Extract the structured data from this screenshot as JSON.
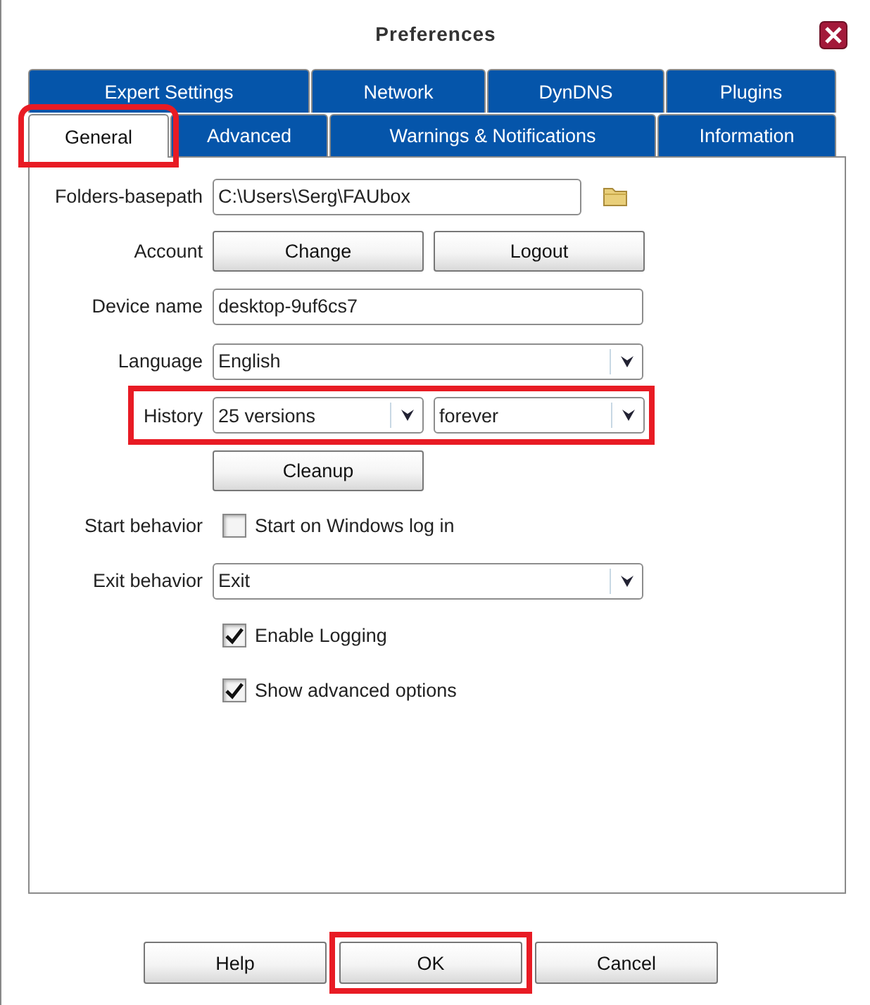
{
  "window": {
    "title": "Preferences"
  },
  "tab_rows": [
    [
      {
        "label": "Expert Settings",
        "selected": false,
        "highlighted": false
      },
      {
        "label": "Network",
        "selected": false,
        "highlighted": false
      },
      {
        "label": "DynDNS",
        "selected": false,
        "highlighted": false
      },
      {
        "label": "Plugins",
        "selected": false,
        "highlighted": false
      }
    ],
    [
      {
        "label": "General",
        "selected": true,
        "highlighted": true
      },
      {
        "label": "Advanced",
        "selected": false,
        "highlighted": false
      },
      {
        "label": "Warnings & Notifications",
        "selected": false,
        "highlighted": false
      },
      {
        "label": "Information",
        "selected": false,
        "highlighted": false
      }
    ]
  ],
  "settings": [
    {
      "kind": "path",
      "label": "Folders-basepath",
      "value": "C:\\Users\\Serg\\FAUbox"
    },
    {
      "kind": "buttons",
      "label": "Account",
      "buttons": [
        "Change",
        "Logout"
      ]
    },
    {
      "kind": "text",
      "label": "Device name",
      "value": "desktop-9uf6cs7"
    },
    {
      "kind": "select",
      "label": "Language",
      "value": "English"
    },
    {
      "kind": "selects",
      "label": "History",
      "values": [
        "25 versions",
        "forever"
      ],
      "highlighted": true
    },
    {
      "kind": "buttons",
      "buttons": [
        "Cleanup"
      ]
    },
    {
      "kind": "checkbox",
      "label": "Start behavior",
      "text": "Start on Windows log in",
      "checked": false
    },
    {
      "kind": "select",
      "label": "Exit behavior",
      "value": "Exit"
    },
    {
      "kind": "checkbox",
      "text": "Enable Logging",
      "checked": true
    },
    {
      "kind": "checkbox",
      "text": "Show advanced options",
      "checked": true
    }
  ],
  "buttons": [
    {
      "label": "Help",
      "highlighted": false
    },
    {
      "label": "OK",
      "highlighted": true
    },
    {
      "label": "Cancel",
      "highlighted": false
    }
  ]
}
